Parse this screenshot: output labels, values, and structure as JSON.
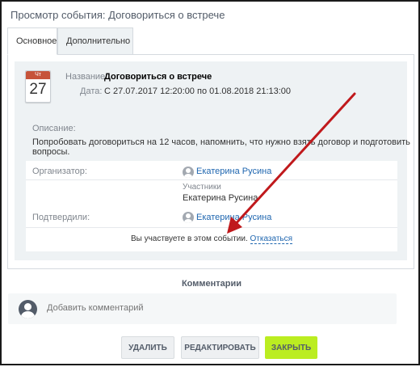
{
  "window": {
    "title": "Просмотр события: Договориться о встрече"
  },
  "tabs": [
    {
      "label": "Основное",
      "active": true
    },
    {
      "label": "Дополнительно",
      "active": false
    }
  ],
  "calendar": {
    "weekday": "Чт",
    "day": "27"
  },
  "event": {
    "name_label": "Название:",
    "name_value": "Договориться о встрече",
    "date_label": "Дата:",
    "date_value": "С 27.07.2017 12:20:00 по 01.08.2018 21:13:00",
    "description_label": "Описание:",
    "description_value": "Попробовать договориться на 12 часов, напомнить, что нужно взять договор и подготовить вопросы."
  },
  "participants": {
    "organizer_label": "Организатор:",
    "organizer_name": "Екатерина Русина",
    "participants_label": "Участники",
    "participants_name": "Екатерина Русина",
    "confirmed_label": "Подтвердили:",
    "confirmed_name": "Екатерина Русина",
    "status_text": "Вы участвуете в этом событии.",
    "decline_link": "Отказаться"
  },
  "comments": {
    "title": "Комментарии",
    "placeholder": "Добавить комментарий"
  },
  "buttons": {
    "delete": "УДАЛИТЬ",
    "edit": "РЕДАКТИРОВАТЬ",
    "close": "ЗАКРЫТЬ"
  },
  "colors": {
    "accent_green": "#bbed21",
    "link": "#2067b0",
    "calendar_header": "#c6533a",
    "annotation_arrow": "#c0191c"
  }
}
